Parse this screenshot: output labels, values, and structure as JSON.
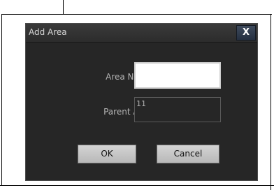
{
  "dialog": {
    "title": "Add Area",
    "close_label": "X"
  },
  "form": {
    "area_name_label": "Area Name:",
    "area_name_value": "",
    "parent_area_label": "Parent Area:",
    "parent_area_value": "11"
  },
  "buttons": {
    "ok_label": "OK",
    "cancel_label": "Cancel"
  },
  "colors": {
    "dialog_bg": "#262626",
    "text": "#b3b3b3"
  }
}
